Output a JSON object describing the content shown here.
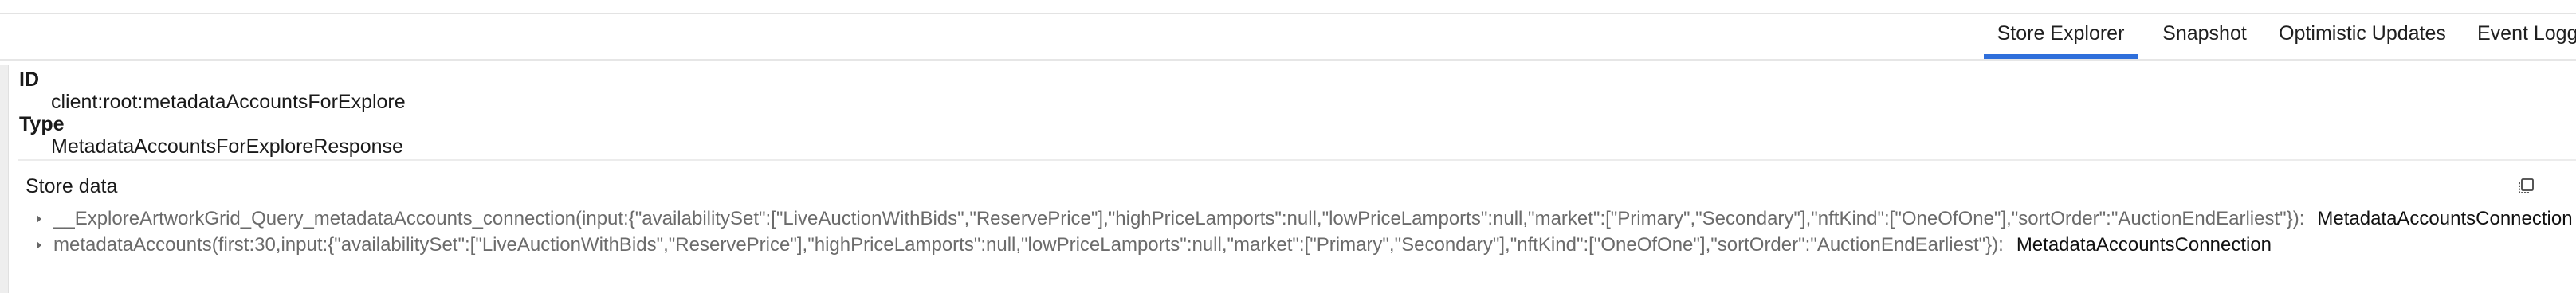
{
  "tabs": [
    {
      "label": "Store Explorer",
      "active": true
    },
    {
      "label": "Snapshot",
      "active": false
    },
    {
      "label": "Optimistic Updates",
      "active": false
    },
    {
      "label": "Event Logger",
      "active": false
    }
  ],
  "record": {
    "id_label": "ID",
    "id_value": "client:root:metadataAccountsForExplore",
    "type_label": "Type",
    "type_value": "MetadataAccountsForExploreResponse"
  },
  "store_data": {
    "title": "Store data",
    "copy_icon": "copy-icon",
    "rows": [
      {
        "field": "__ExploreArtworkGrid_Query_metadataAccounts_connection(input:{\"availabilitySet\":[\"LiveAuctionWithBids\",\"ReservePrice\"],\"highPriceLamports\":null,\"lowPriceLamports\":null,\"market\":[\"Primary\",\"Secondary\"],\"nftKind\":[\"OneOfOne\"],\"sortOrder\":\"AuctionEndEarliest\"})",
        "separator": ":",
        "type": "MetadataAccountsConnection",
        "expanded": false
      },
      {
        "field": "metadataAccounts(first:30,input:{\"availabilitySet\":[\"LiveAuctionWithBids\",\"ReservePrice\"],\"highPriceLamports\":null,\"lowPriceLamports\":null,\"market\":[\"Primary\",\"Secondary\"],\"nftKind\":[\"OneOfOne\"],\"sortOrder\":\"AuctionEndEarliest\"})",
        "separator": ":",
        "type": "MetadataAccountsConnection",
        "expanded": false
      }
    ]
  }
}
